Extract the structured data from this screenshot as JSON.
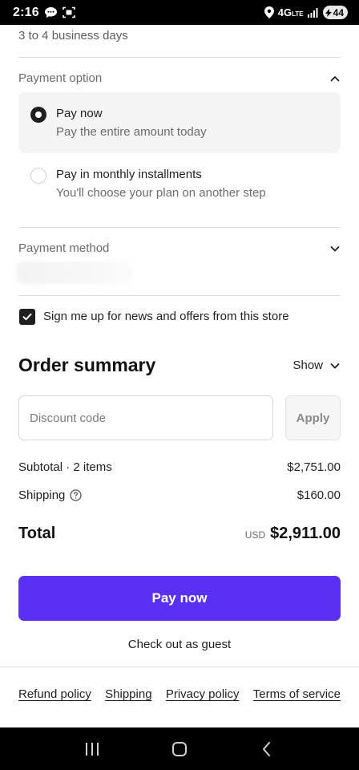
{
  "status_bar": {
    "time": "2:16",
    "network": "4G",
    "network_suffix": "LTE",
    "battery": "44"
  },
  "delivery": {
    "time_text": "3 to 4 business days"
  },
  "payment_option": {
    "title": "Payment option",
    "options": [
      {
        "title": "Pay now",
        "subtitle": "Pay the entire amount today",
        "selected": true
      },
      {
        "title": "Pay in monthly installments",
        "subtitle": "You'll choose your plan on another step",
        "selected": false
      }
    ]
  },
  "payment_method": {
    "title": "Payment method"
  },
  "newsletter": {
    "label": "Sign me up for news and offers from this store",
    "checked": true
  },
  "order_summary": {
    "title": "Order summary",
    "toggle_label": "Show",
    "discount_placeholder": "Discount code",
    "apply_label": "Apply",
    "subtotal_label": "Subtotal · 2 items",
    "subtotal_value": "$2,751.00",
    "shipping_label": "Shipping",
    "shipping_value": "$160.00",
    "total_label": "Total",
    "total_currency": "USD",
    "total_value": "$2,911.00"
  },
  "actions": {
    "pay_now_label": "Pay now",
    "guest_label": "Check out as guest"
  },
  "footer": {
    "links": [
      "Refund policy",
      "Shipping",
      "Privacy policy",
      "Terms of service"
    ]
  },
  "colors": {
    "accent": "#5a31f4",
    "text": "#1f1f1f",
    "muted": "#6b6b6b"
  },
  "icons": {
    "status_left": [
      "chat-bubble-icon",
      "screenshot-icon"
    ],
    "status_right": [
      "location-pin-icon",
      "signal-bars-icon",
      "battery-icon"
    ],
    "nav": [
      "recents-icon",
      "home-icon",
      "back-icon"
    ]
  }
}
